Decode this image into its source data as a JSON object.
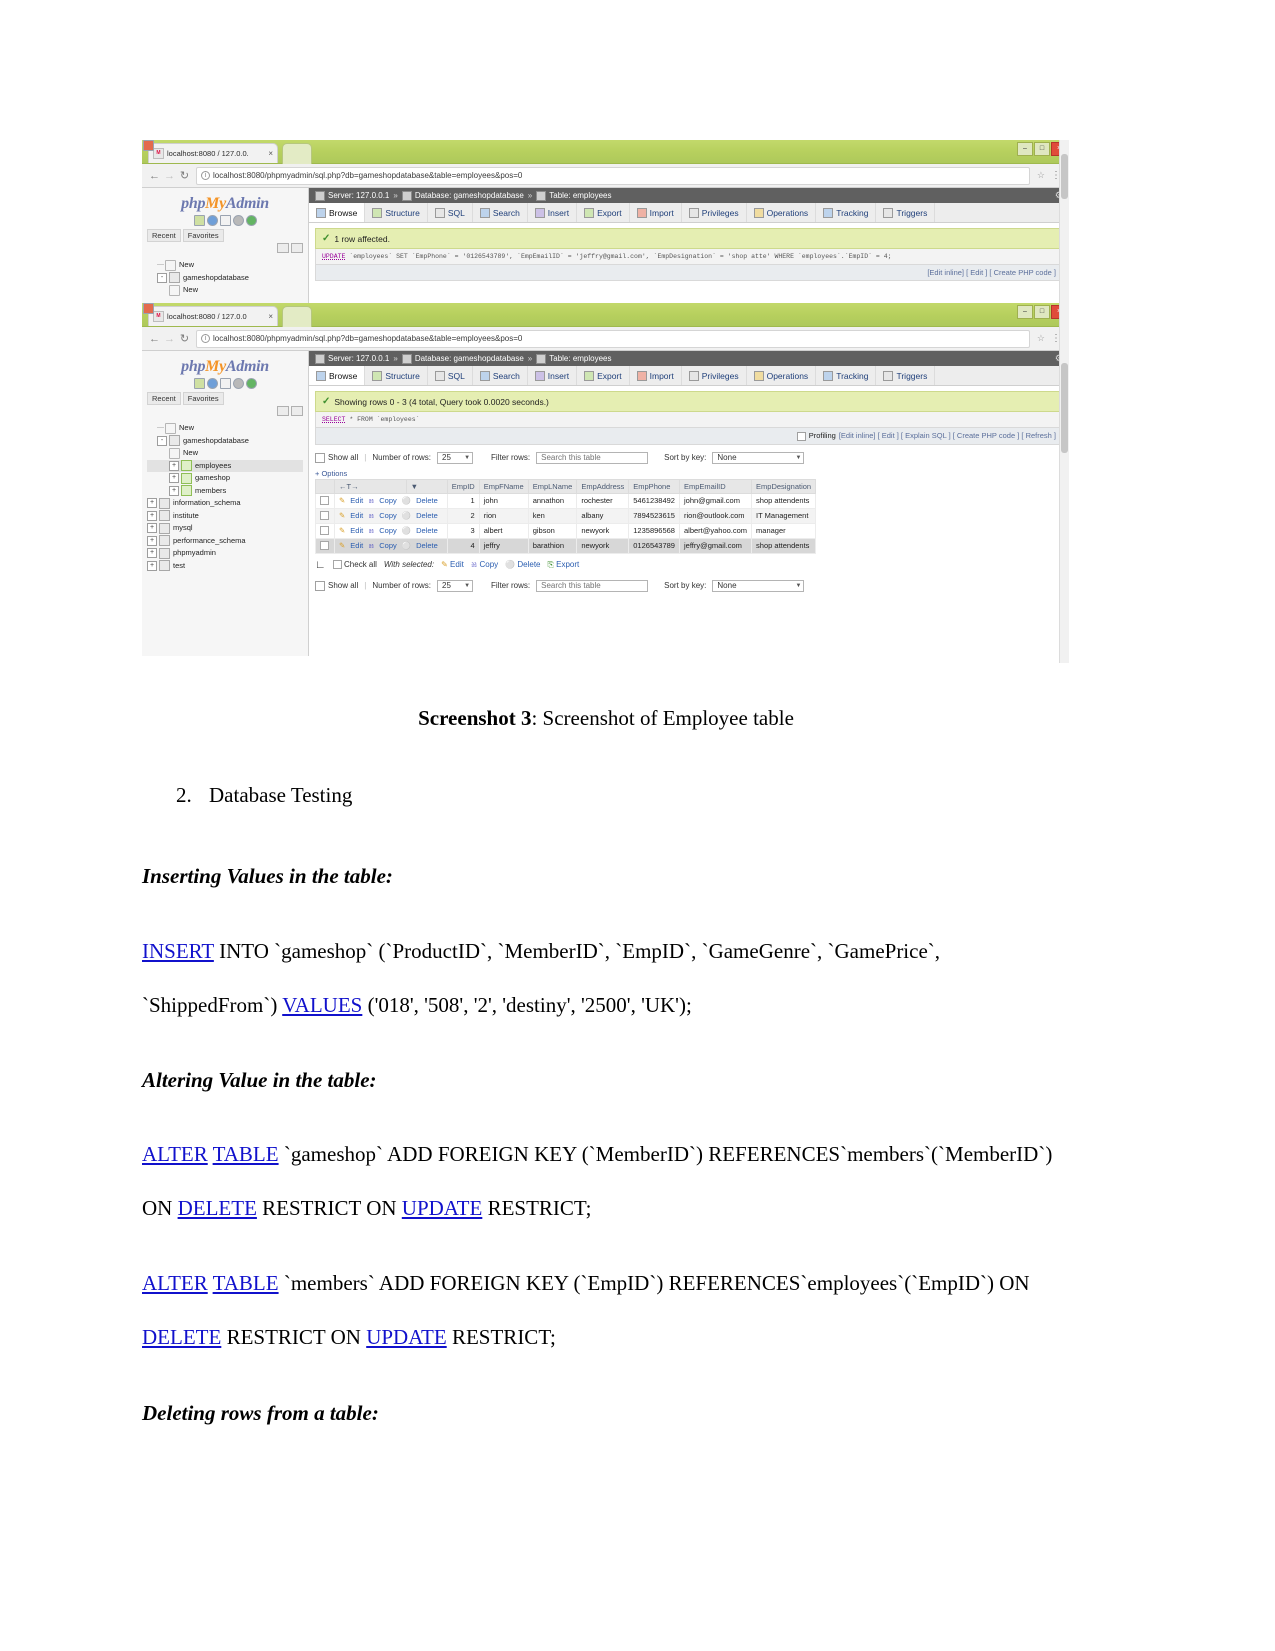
{
  "figure": {
    "caption_bold": "Screenshot 3",
    "caption_rest": ": Screenshot of Employee table",
    "browser_top": {
      "tab_title": "localhost:8080 / 127.0.0.",
      "tab_close": "×",
      "favicon_label": "M",
      "url": "localhost:8080/phpmyadmin/sql.php?db=gameshopdatabase&table=employees&pos=0",
      "back_icon": "←",
      "forward_icon": "→",
      "reload_icon": "↻",
      "info_icon": "i",
      "star_icon": "☆",
      "menu_icon": "⋮",
      "minimize": "–",
      "maximize": "□",
      "close": "×"
    },
    "browser_bottom": {
      "tab_title": "localhost:8080 / 127.0.0",
      "url": "localhost:8080/phpmyadmin/sql.php?db=gameshopdatabase&table=employees&pos=0"
    },
    "pma": {
      "logo_php": "php",
      "logo_my": "My",
      "logo_admin": "Admin",
      "quick_tabs": [
        "Recent",
        "Favorites"
      ],
      "tree": [
        {
          "label": "New",
          "level": 1,
          "type": "new",
          "expander": "",
          "selected": false
        },
        {
          "label": "gameshopdatabase",
          "level": 1,
          "type": "db",
          "expander": "-",
          "selected": false
        },
        {
          "label": "New",
          "level": 2,
          "type": "new",
          "expander": "",
          "selected": false
        },
        {
          "label": "employees",
          "level": 2,
          "type": "table",
          "expander": "+",
          "selected": true
        },
        {
          "label": "gameshop",
          "level": 2,
          "type": "table",
          "expander": "+",
          "selected": false
        },
        {
          "label": "members",
          "level": 2,
          "type": "table",
          "expander": "+",
          "selected": false
        },
        {
          "label": "information_schema",
          "level": 1,
          "type": "db",
          "expander": "+",
          "selected": false
        },
        {
          "label": "institute",
          "level": 1,
          "type": "db",
          "expander": "+",
          "selected": false
        },
        {
          "label": "mysql",
          "level": 1,
          "type": "db",
          "expander": "+",
          "selected": false
        },
        {
          "label": "performance_schema",
          "level": 1,
          "type": "db",
          "expander": "+",
          "selected": false
        },
        {
          "label": "phpmyadmin",
          "level": 1,
          "type": "db",
          "expander": "+",
          "selected": false
        },
        {
          "label": "test",
          "level": 1,
          "type": "db",
          "expander": "+",
          "selected": false
        }
      ],
      "breadcrumb": {
        "server_label": "Server: 127.0.0.1",
        "database_label": "Database: gameshopdatabase",
        "table_label": "Table: employees",
        "sep": "»"
      },
      "tabs": [
        "Browse",
        "Structure",
        "SQL",
        "Search",
        "Insert",
        "Export",
        "Import",
        "Privileges",
        "Operations",
        "Tracking",
        "Triggers"
      ],
      "active_tab": "Browse",
      "top_panel": {
        "alert": "1 row affected.",
        "sql_kw1": "UPDATE",
        "sql_rest": "`employees` SET `EmpPhone` = '0126543789', `EmpEmailID` = 'jeffry@gmail.com', `EmpDesignation` = 'shop atte' WHERE `employees`.`EmpID` = 4;",
        "actions": "[Edit inline] [ Edit ] [ Create PHP code ]"
      },
      "bottom_panel": {
        "alert": "Showing rows 0 - 3 (4 total, Query took 0.0020 seconds.)",
        "sql_kw1": "SELECT",
        "sql_rest": "* FROM `employees`",
        "profiling_label": "Profiling",
        "actions": "[Edit inline] [ Edit ] [ Explain SQL ] [ Create PHP code ] [ Refresh ]",
        "options_toggle": "+ Options",
        "controls": {
          "show_all": "Show all",
          "number_of_rows_label": "Number of rows:",
          "number_of_rows_value": "25",
          "filter_rows_label": "Filter rows:",
          "filter_rows_placeholder": "Search this table",
          "sort_by_key_label": "Sort by key:",
          "sort_by_key_value": "None"
        },
        "grid": {
          "action_labels": {
            "edit": "Edit",
            "copy": "Copy",
            "delete": "Delete"
          },
          "sort_arrows": "←T→",
          "columns": [
            "EmpID",
            "EmpFName",
            "EmpLName",
            "EmpAddress",
            "EmpPhone",
            "EmpEmailID",
            "EmpDesignation"
          ],
          "rows": [
            {
              "EmpID": "1",
              "EmpFName": "john",
              "EmpLName": "annathon",
              "EmpAddress": "rochester",
              "EmpPhone": "5461238492",
              "EmpEmailID": "john@gmail.com",
              "EmpDesignation": "shop attendents",
              "highlight": false
            },
            {
              "EmpID": "2",
              "EmpFName": "rion",
              "EmpLName": "ken",
              "EmpAddress": "albany",
              "EmpPhone": "7894523615",
              "EmpEmailID": "rion@outlook.com",
              "EmpDesignation": "IT Management",
              "highlight": false
            },
            {
              "EmpID": "3",
              "EmpFName": "albert",
              "EmpLName": "gibson",
              "EmpAddress": "newyork",
              "EmpPhone": "1235896568",
              "EmpEmailID": "albert@yahoo.com",
              "EmpDesignation": "manager",
              "highlight": false
            },
            {
              "EmpID": "4",
              "EmpFName": "jeffry",
              "EmpLName": "barathion",
              "EmpAddress": "newyork",
              "EmpPhone": "0126543789",
              "EmpEmailID": "jeffry@gmail.com",
              "EmpDesignation": "shop attendents",
              "highlight": true
            }
          ]
        },
        "footer": {
          "check_all": "Check all",
          "with_selected": "With selected:",
          "edit": "Edit",
          "copy": "Copy",
          "delete": "Delete",
          "export": "Export"
        },
        "controls2": {
          "show_all": "Show all",
          "number_of_rows_label": "Number of rows:",
          "number_of_rows_value": "25",
          "filter_rows_label": "Filter rows:",
          "filter_rows_placeholder": "Search this table",
          "sort_by_key_label": "Sort by key:",
          "sort_by_key_value": "None"
        }
      }
    }
  },
  "document": {
    "list_number": "2.",
    "list_text": "Database Testing",
    "section_insert_heading": "Inserting Values in the table:",
    "insert_link": "INSERT",
    "insert_body1": " INTO `gameshop` (`ProductID`, `MemberID`, `EmpID`, `GameGenre`, `GamePrice`, `ShippedFrom`) ",
    "values_link": "VALUES",
    "insert_body2": " ('018', '508', '2', 'destiny', '2500', 'UK');",
    "section_alter_heading": "Altering Value in the table:",
    "alter_link": "ALTER",
    "table_link": "TABLE",
    "alter1_body1": " `gameshop` ADD FOREIGN KEY (`MemberID`) REFERENCES`members`(`MemberID`) ON ",
    "delete_link": "DELETE",
    "alter1_body2": " RESTRICT ON ",
    "update_link": "UPDATE",
    "alter1_body3": " RESTRICT;",
    "alter2_body1": " `members` ADD FOREIGN KEY (`EmpID`) REFERENCES`employees`(`EmpID`) ON ",
    "alter2_body2": " RESTRICT ON ",
    "alter2_body3": " RESTRICT;",
    "section_delete_heading": "Deleting rows from a table:"
  }
}
